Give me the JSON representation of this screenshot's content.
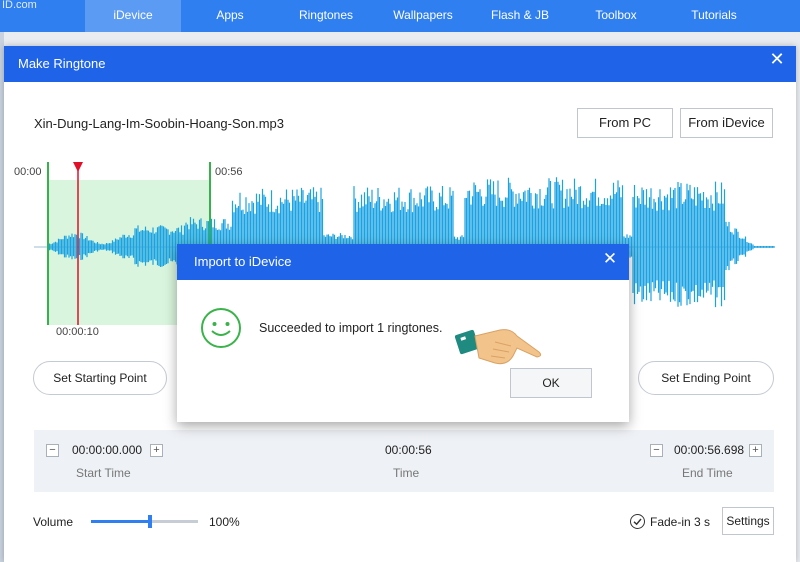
{
  "topnav": {
    "brand": "ID.com",
    "tabs": [
      "iDevice",
      "Apps",
      "Ringtones",
      "Wallpapers",
      "Flash & JB",
      "Toolbox",
      "Tutorials"
    ],
    "active_tab": "iDevice"
  },
  "dialog": {
    "title": "Make Ringtone",
    "close": "✕",
    "file_name": "Xin-Dung-Lang-Im-Soobin-Hoang-Son.mp3",
    "from_pc": "From PC",
    "from_idevice": "From iDevice"
  },
  "waveform": {
    "start_label": "00:00",
    "selection_end_label": "00:56",
    "playhead_label": "00:00:10",
    "selection_color": "#d9f5dd",
    "wave_color": "#1aa3e2",
    "playhead_color": "#e0102a",
    "marker_color": "#35b24a"
  },
  "buttons": {
    "set_start": "Set Starting Point",
    "set_end": "Set Ending Point",
    "settings": "Settings"
  },
  "time_panel": {
    "minus": "−",
    "plus": "+",
    "start_value": "00:00:00.000",
    "start_label": "Start Time",
    "time_value": "00:00:56",
    "time_label": "Time",
    "end_value": "00:00:56.698",
    "end_label": "End Time"
  },
  "volume": {
    "label": "Volume",
    "value": "100%",
    "level": 0.55
  },
  "fade": {
    "label": "Fade-in 3 s",
    "checked": true
  },
  "popup": {
    "title": "Import to iDevice",
    "close": "✕",
    "message": "Succeeded to import 1 ringtones.",
    "ok": "OK",
    "icon": "smile-icon",
    "pointer_icon": "pointing-hand-icon"
  },
  "colors": {
    "accent": "#1f63e8",
    "nav": "#2f7ff0"
  }
}
